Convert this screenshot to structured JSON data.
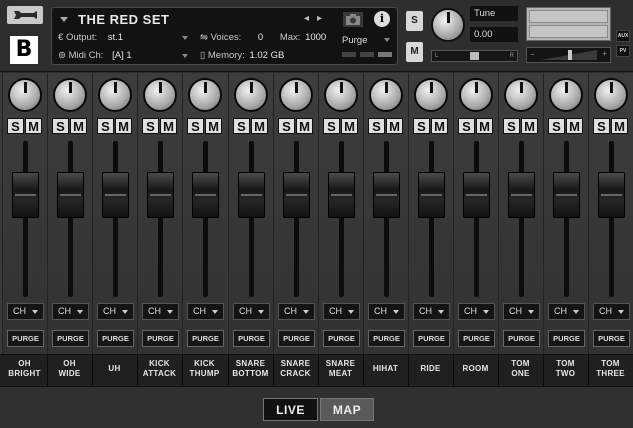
{
  "header": {
    "instrument_title": "THE RED SET",
    "output_label": "Output:",
    "output_value": "st.1",
    "voices_label": "Voices:",
    "voices_value": "0",
    "max_label": "Max:",
    "max_value": "1000",
    "purge_label": "Purge",
    "midi_label": "Midi Ch:",
    "midi_value": "[A]  1",
    "memory_label": "Memory:",
    "memory_value": "1.02 GB",
    "solo_label": "S",
    "mute_label": "M",
    "tune_label": "Tune",
    "tune_value": "0.00",
    "pan_left": "L",
    "pan_right": "R",
    "vol_minus": "−",
    "vol_plus": "+",
    "aux_label": "AUX",
    "pv_label": "PV",
    "logo": "B"
  },
  "mixer": {
    "solo_label": "S",
    "mute_label": "M",
    "channel_label": "CH",
    "purge_label": "PURGE",
    "channels": [
      {
        "name": "OH BRIGHT",
        "line1": "OH",
        "line2": "BRIGHT",
        "fader_level": 0.72
      },
      {
        "name": "OH WIDE",
        "line1": "OH",
        "line2": "WIDE",
        "fader_level": 0.72
      },
      {
        "name": "UH",
        "line1": "UH",
        "line2": "",
        "fader_level": 0.72
      },
      {
        "name": "KICK ATTACK",
        "line1": "KICK",
        "line2": "ATTACK",
        "fader_level": 0.72
      },
      {
        "name": "KICK THUMP",
        "line1": "KICK",
        "line2": "THUMP",
        "fader_level": 0.72
      },
      {
        "name": "SNARE BOTTOM",
        "line1": "SNARE",
        "line2": "BOTTOM",
        "fader_level": 0.72
      },
      {
        "name": "SNARE CRACK",
        "line1": "SNARE",
        "line2": "CRACK",
        "fader_level": 0.72
      },
      {
        "name": "SNARE MEAT",
        "line1": "SNARE",
        "line2": "MEAT",
        "fader_level": 0.72
      },
      {
        "name": "HIHAT",
        "line1": "HIHAT",
        "line2": "",
        "fader_level": 0.72
      },
      {
        "name": "RIDE",
        "line1": "RIDE",
        "line2": "",
        "fader_level": 0.72
      },
      {
        "name": "ROOM",
        "line1": "ROOM",
        "line2": "",
        "fader_level": 0.72
      },
      {
        "name": "TOM ONE",
        "line1": "TOM",
        "line2": "ONE",
        "fader_level": 0.72
      },
      {
        "name": "TOM TWO",
        "line1": "TOM",
        "line2": "TWO",
        "fader_level": 0.72
      },
      {
        "name": "TOM THREE",
        "line1": "TOM",
        "line2": "THREE",
        "fader_level": 0.72
      }
    ]
  },
  "footer": {
    "tabs": [
      {
        "label": "LIVE",
        "active": true
      },
      {
        "label": "MAP",
        "active": false
      }
    ]
  }
}
